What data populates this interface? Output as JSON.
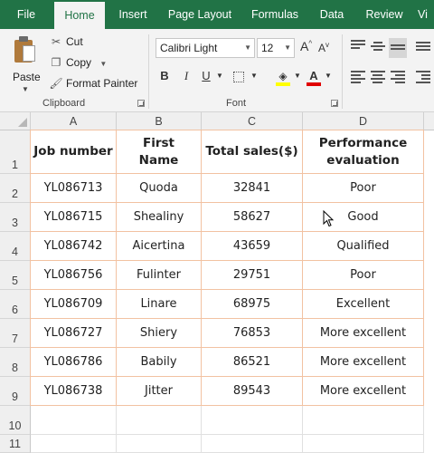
{
  "ribbon_tabs": [
    "File",
    "Home",
    "Insert",
    "Page Layout",
    "Formulas",
    "Data",
    "Review",
    "Vi"
  ],
  "active_tab": "Home",
  "clipboard": {
    "paste_label": "Paste",
    "cut_label": "Cut",
    "copy_label": "Copy",
    "format_painter_label": "Format Painter",
    "group_label": "Clipboard"
  },
  "font": {
    "font_name": "Calibri Light",
    "font_size": "12",
    "bold": "B",
    "italic": "I",
    "underline": "U",
    "grow_label": "A",
    "shrink_label": "A",
    "font_color_label": "A",
    "group_label": "Font",
    "fill_color": "#ffff00",
    "font_color": "#e00000"
  },
  "columns": [
    "A",
    "B",
    "C",
    "D"
  ],
  "rows": [
    "1",
    "2",
    "3",
    "4",
    "5",
    "6",
    "7",
    "8",
    "9",
    "10",
    "11"
  ],
  "table": {
    "headers": [
      "Job number",
      "First Name",
      "Total sales($)",
      "Performance evaluation"
    ],
    "data": [
      [
        "YL086713",
        "Quoda",
        "32841",
        "Poor"
      ],
      [
        "YL086715",
        "Shealiny",
        "58627",
        "Good"
      ],
      [
        "YL086742",
        "Aicertina",
        "43659",
        "Qualified"
      ],
      [
        "YL086756",
        "Fulinter",
        "29751",
        "Poor"
      ],
      [
        "YL086709",
        "Linare",
        "68975",
        "Excellent"
      ],
      [
        "YL086727",
        "Shiery",
        "76853",
        "More excellent"
      ],
      [
        "YL086786",
        "Babily",
        "86521",
        "More excellent"
      ],
      [
        "YL086738",
        "Jitter",
        "89543",
        "More excellent"
      ]
    ]
  },
  "colors": {
    "ribbon_green": "#217346",
    "table_border": "#f2c2a2"
  }
}
